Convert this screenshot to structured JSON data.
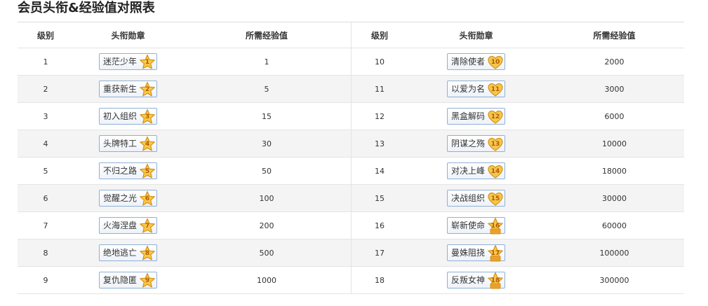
{
  "title": "会员头衔&经验值对照表",
  "headers": {
    "level": "级别",
    "badge": "头衔勋章",
    "exp": "所需经验值"
  },
  "colors": {
    "star_fill": "#f7c948",
    "star_stroke": "#d8901a",
    "heart_fill": "#f4c74c",
    "badge_border": "#8fb0d6"
  },
  "rows": [
    {
      "left": {
        "level": "1",
        "name": "迷茫少年",
        "icon": "star-icon",
        "num": "1",
        "exp": "1"
      },
      "right": {
        "level": "10",
        "name": "清除使者",
        "icon": "heart-icon",
        "num": "10",
        "exp": "2000"
      }
    },
    {
      "left": {
        "level": "2",
        "name": "重获新生",
        "icon": "star-icon",
        "num": "2",
        "exp": "5"
      },
      "right": {
        "level": "11",
        "name": "以爱为名",
        "icon": "heart-icon",
        "num": "11",
        "exp": "3000"
      }
    },
    {
      "left": {
        "level": "3",
        "name": "初入组织",
        "icon": "star-icon",
        "num": "3",
        "exp": "15"
      },
      "right": {
        "level": "12",
        "name": "黑盒解码",
        "icon": "heart-icon",
        "num": "12",
        "exp": "6000"
      }
    },
    {
      "left": {
        "level": "4",
        "name": "头牌特工",
        "icon": "star-icon",
        "num": "4",
        "exp": "30"
      },
      "right": {
        "level": "13",
        "name": "阴谋之殇",
        "icon": "heart-icon",
        "num": "13",
        "exp": "10000"
      }
    },
    {
      "left": {
        "level": "5",
        "name": "不归之路",
        "icon": "star-icon",
        "num": "5",
        "exp": "50"
      },
      "right": {
        "level": "14",
        "name": "对决上峰",
        "icon": "heart-icon",
        "num": "14",
        "exp": "18000"
      }
    },
    {
      "left": {
        "level": "6",
        "name": "觉醒之光",
        "icon": "star-icon",
        "num": "6",
        "exp": "100"
      },
      "right": {
        "level": "15",
        "name": "决战组织",
        "icon": "heart-icon",
        "num": "15",
        "exp": "30000"
      }
    },
    {
      "left": {
        "level": "7",
        "name": "火海涅盘",
        "icon": "star-icon",
        "num": "7",
        "exp": "200"
      },
      "right": {
        "level": "16",
        "name": "崭新使命",
        "icon": "crown-star-icon",
        "num": "16",
        "exp": "60000"
      }
    },
    {
      "left": {
        "level": "8",
        "name": "绝地逃亡",
        "icon": "star-icon",
        "num": "8",
        "exp": "500"
      },
      "right": {
        "level": "17",
        "name": "曼姝阻挠",
        "icon": "crown-star-icon",
        "num": "17",
        "exp": "100000"
      }
    },
    {
      "left": {
        "level": "9",
        "name": "复仇隐匿",
        "icon": "star-icon",
        "num": "9",
        "exp": "1000"
      },
      "right": {
        "level": "18",
        "name": "反叛女神",
        "icon": "crown-star-icon",
        "num": "18",
        "exp": "300000"
      }
    }
  ]
}
